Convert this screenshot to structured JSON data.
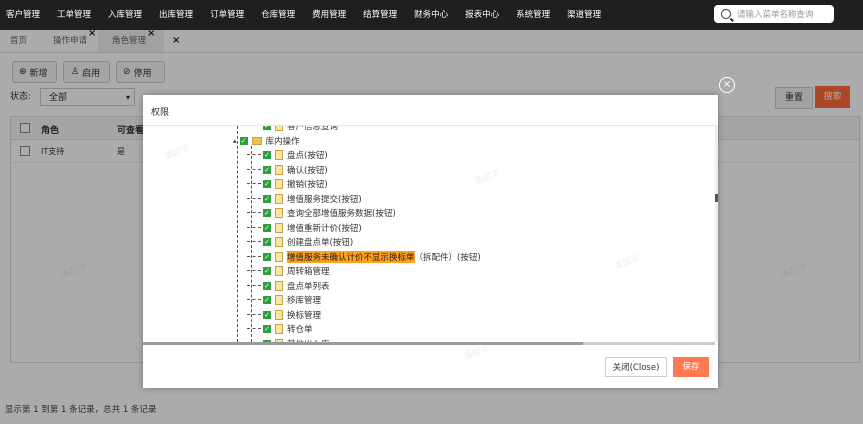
{
  "top_menu": [
    "客户管理",
    "工单管理",
    "入库管理",
    "出库管理",
    "订单管理",
    "仓库管理",
    "费用管理",
    "结算管理",
    "财务中心",
    "报表中心",
    "系统管理",
    "渠道管理"
  ],
  "search": {
    "placeholder": "请输入菜单名称查询"
  },
  "tabs": [
    {
      "label": "首页",
      "closable": false
    },
    {
      "label": "操作申请",
      "closable": true
    },
    {
      "label": "角色管理",
      "closable": true
    },
    {
      "label": "",
      "closable": true
    }
  ],
  "toolbar": {
    "add": "新增",
    "enable": "启用",
    "disable": "停用"
  },
  "filter": {
    "status_label": "状态:",
    "status_value": "全部",
    "reset": "重置",
    "search": "搜索"
  },
  "grid": {
    "headers": [
      "角色",
      "可查看"
    ],
    "rows": [
      [
        "IT支持",
        "是"
      ]
    ]
  },
  "status_bar": "显示第 1 到第 1 条记录，总共 1 条记录",
  "watermark": "潘超华",
  "modal": {
    "title": "权限",
    "close_symbol": "×",
    "tree": [
      {
        "label": "客户信息查询",
        "level": 2,
        "type": "page"
      },
      {
        "label": "库内操作",
        "level": 1,
        "type": "folder"
      },
      {
        "label": "盘点(按钮)",
        "level": 2,
        "type": "page"
      },
      {
        "label": "确认(按钮)",
        "level": 2,
        "type": "page"
      },
      {
        "label": "撤销(按钮)",
        "level": 2,
        "type": "page"
      },
      {
        "label": "增值服务提交(按钮)",
        "level": 2,
        "type": "page"
      },
      {
        "label": "查询全部增值服务数据(按钮)",
        "level": 2,
        "type": "page"
      },
      {
        "label": "增值重新计价(按钮)",
        "level": 2,
        "type": "page"
      },
      {
        "label": "创建盘点单(按钮)",
        "level": 2,
        "type": "page"
      },
      {
        "label": "增值服务未确认计价不显示换标单",
        "suffix": "（拆配件）(按钮)",
        "level": 2,
        "type": "page",
        "highlight": true
      },
      {
        "label": "周转箱管理",
        "level": 2,
        "type": "page"
      },
      {
        "label": "盘点单列表",
        "level": 2,
        "type": "page"
      },
      {
        "label": "移库管理",
        "level": 2,
        "type": "page"
      },
      {
        "label": "换标管理",
        "level": 2,
        "type": "page"
      },
      {
        "label": "转仓单",
        "level": 2,
        "type": "page"
      },
      {
        "label": "其他出入库",
        "level": 2,
        "type": "page"
      }
    ],
    "close_button": "关闭(Close)",
    "save_button": "保存"
  },
  "colors": {
    "accent": "#ff6a3a",
    "topbar": "#1f1f1f",
    "check": "#2e9e3e",
    "highlight": "#ffa020"
  }
}
